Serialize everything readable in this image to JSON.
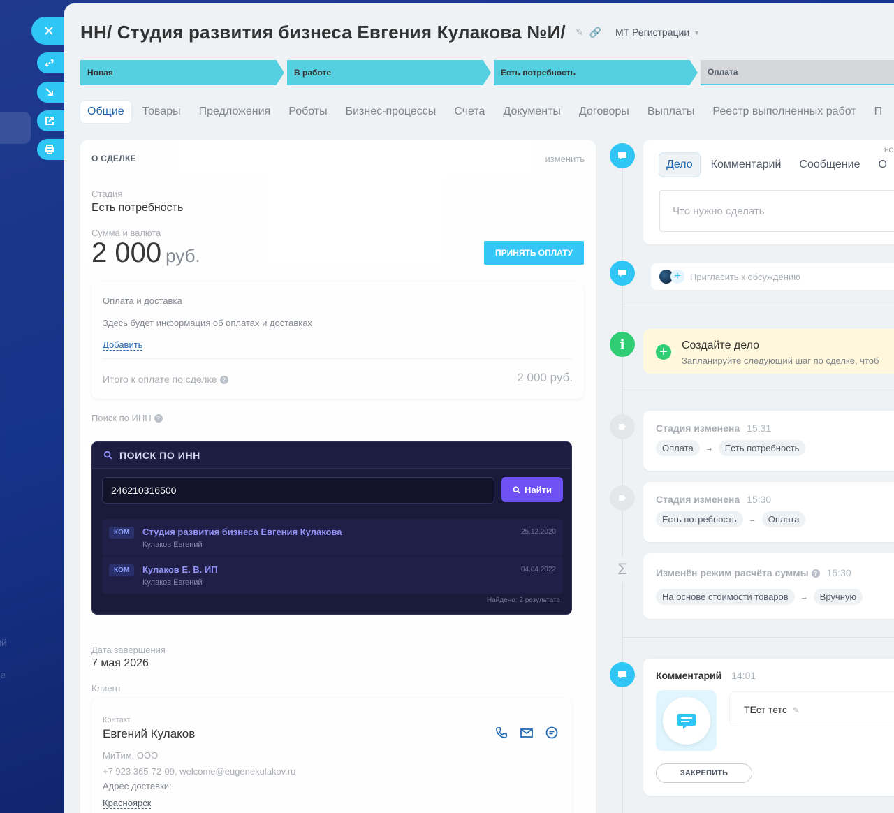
{
  "background": {
    "left_text_1": "ий",
    "left_text_2": "зе"
  },
  "window": {
    "title": "НН/ Студия развития бизнеса Евгения Кулакова №И/",
    "category": "МТ Регистрации"
  },
  "stages": [
    {
      "label": "Новая"
    },
    {
      "label": "В работе"
    },
    {
      "label": "Есть потребность"
    },
    {
      "label": "Оплата"
    }
  ],
  "tabs": [
    "Общие",
    "Товары",
    "Предложения",
    "Роботы",
    "Бизнес-процессы",
    "Счета",
    "Документы",
    "Договоры",
    "Выплаты",
    "Реестр выполненных работ",
    "П"
  ],
  "deal": {
    "section_title": "О СДЕЛКЕ",
    "change_link": "изменить",
    "stage_label": "Стадия",
    "stage_value": "Есть потребность",
    "amount_label": "Сумма и валюта",
    "amount_value": "2 000",
    "currency": "руб.",
    "accept_payment_button": "ПРИНЯТЬ ОПЛАТУ",
    "payment": {
      "label": "Оплата и доставка",
      "info": "Здесь будет информация об оплатах и доставках",
      "add_link": "Добавить",
      "total_label": "Итого к оплате по сделке",
      "total_value": "2 000 руб."
    },
    "inn_label": "Поиск по ИНН",
    "inn_widget": {
      "header": "ПОИСК ПО ИНН",
      "input_value": "246210316500",
      "search_button": "Найти",
      "results": [
        {
          "badge": "КОМ",
          "name": "Студия развития бизнеса Евгения Кулакова",
          "sub": "Кулаков Евгений",
          "date": "25.12.2020"
        },
        {
          "badge": "КОМ",
          "name": "Кулаков Е. В. ИП",
          "sub": "Кулаков Евгений",
          "date": "04.04.2022"
        }
      ],
      "found_text": "Найдено: 2 результата"
    },
    "close_date_label": "Дата завершения",
    "close_date_value": "7 мая 2026",
    "client_label": "Клиент",
    "client": {
      "contact_label": "Контакт",
      "name": "Евгений Кулаков",
      "company": "МиТим, ООО",
      "contacts_line": "+7 923 365-72-09, welcome@eugenekulakov.ru",
      "address_label": "Адрес доставки:",
      "city": "Красноярск"
    }
  },
  "activity": {
    "tabs": [
      "Дело",
      "Комментарий",
      "Сообщение",
      "О"
    ],
    "more": "НО",
    "input_placeholder": "Что нужно сделать",
    "invite_text": "Пригласить к обсуждению",
    "create_title": "Создайте дело",
    "create_sub": "Запланируйте следующий шаг по сделке, чтоб"
  },
  "timeline": [
    {
      "title": "Стадия изменена",
      "time": "15:31",
      "from": "Оплата",
      "to": "Есть потребность"
    },
    {
      "title": "Стадия изменена",
      "time": "15:30",
      "from": "Есть потребность",
      "to": "Оплата"
    },
    {
      "title": "Изменён режим расчёта суммы",
      "time": "15:30",
      "from": "На основе стоимости товаров",
      "to": "Вручную"
    }
  ],
  "comment": {
    "title": "Комментарий",
    "time": "14:01",
    "text": "ТЕст тетс",
    "pin_button": "ЗАКРЕПИТЬ"
  },
  "colors": {
    "accent": "#2fc6f6",
    "stage": "#55d0e0",
    "inn_button": "#6a4cf6",
    "link": "#2067b0"
  }
}
